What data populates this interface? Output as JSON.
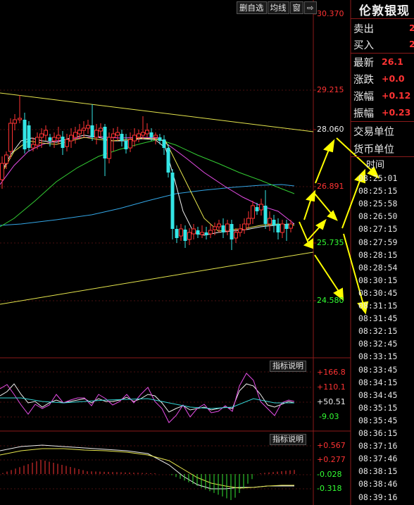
{
  "toolbar": {
    "delete_self_select": "删自选",
    "moving_average": "均线",
    "window": "窗",
    "pin_icon": "pin-icon"
  },
  "price_axis": {
    "labels": [
      "30.370",
      "29.215",
      "28.060",
      "26.891",
      "25.735",
      "24.580"
    ]
  },
  "indicator_panels": [
    {
      "button_label": "指标说明",
      "axis_labels": [
        "+166.8",
        "+110.1",
        "+50.51",
        "-9.03"
      ]
    },
    {
      "button_label": "指标说明",
      "axis_labels": [
        "+0.567",
        "+0.277",
        "-0.028",
        "-0.318"
      ]
    }
  ],
  "quote_panel": {
    "title": "伦敦银现",
    "rows": [
      {
        "label": "卖出",
        "value": "2"
      },
      {
        "label": "买入",
        "value": "2"
      },
      {
        "label": "最新",
        "value": "26.1"
      },
      {
        "label": "涨跌",
        "value": "+0.0"
      },
      {
        "label": "涨幅",
        "value": "+0.12"
      },
      {
        "label": "振幅",
        "value": "+0.23"
      },
      {
        "label": "交易单位",
        "value": ""
      },
      {
        "label": "货币单位",
        "value": ""
      }
    ],
    "time_header": "时间",
    "times": [
      "08:25:01",
      "08:25:15",
      "08:25:58",
      "08:26:50",
      "08:27:15",
      "08:27:59",
      "08:28:15",
      "08:28:54",
      "08:30:15",
      "08:30:45",
      "08:31:15",
      "08:31:45",
      "08:32:15",
      "08:32:45",
      "08:33:15",
      "08:33:45",
      "08:34:15",
      "08:34:45",
      "08:35:15",
      "08:35:45",
      "08:36:15",
      "08:37:16",
      "08:37:46",
      "08:38:15",
      "08:38:46",
      "08:39:16"
    ]
  },
  "colors": {
    "up_candle": "#ff3333",
    "down_candle": "#33e6e6",
    "border": "#8b1a1a",
    "arrow": "#ffff00"
  }
}
